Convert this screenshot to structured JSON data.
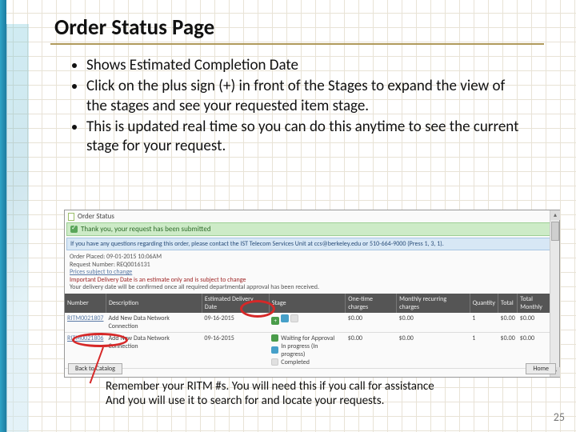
{
  "title": "Order Status Page",
  "bullets": [
    "Shows Estimated Completion Date",
    "Click on the plus sign (+) in front of the Stages to expand  the view of the stages and see your requested item stage.",
    "This is updated real time so you can do this anytime to see the current stage for your request."
  ],
  "screenshot": {
    "window_title": "Order Status",
    "confirm_msg": "Thank you, your request has been submitted",
    "contact_msg": "If you have any questions regarding this order, please contact the IST Telecom Services Unit at ccs@berkeley.edu or 510-664-9000 (Press 1, 3, 1).",
    "meta": {
      "order_placed_label": "Order Placed:",
      "order_placed_value": "09-01-2015 10:06AM",
      "request_label": "Request Number:",
      "request_value": "REQ0016131",
      "prices_link": "Prices subject to change",
      "important": "Important Delivery Date is an estimate only and is subject to change",
      "delivery_note": "Your delivery date will be confirmed once all required departmental approval has been received."
    },
    "columns": [
      "Number",
      "Description",
      "Estimated Delivery Date",
      "Stage",
      "One-time charges",
      "Monthly recurring charges",
      "Quantity",
      "Total",
      "Total Monthly"
    ],
    "rows": [
      {
        "number": "RITM0021807",
        "desc": "Add New Data Network Connection",
        "date": "09-16-2015",
        "one": "$0.00",
        "mon": "$0.00",
        "qty": "1",
        "tot": "$0.00",
        "totm": "$0.00"
      },
      {
        "number": "RITM0021806",
        "desc": "Add New Data Network Connection",
        "date": "09-16-2015",
        "one": "$0.00",
        "mon": "$0.00",
        "qty": "1",
        "tot": "$0.00",
        "totm": "$0.00"
      }
    ],
    "stages": {
      "waiting": "Waiting for Approval",
      "inprog": "In progress (In progress)",
      "completed": "Completed"
    },
    "back_btn": "Back to Catalog",
    "home_btn": "Home"
  },
  "remember": {
    "l1": "Remember your RITM #s.   You will need this if you call for assistance",
    "l2": "And you will use it to search for and locate your requests."
  },
  "page_number": "25"
}
